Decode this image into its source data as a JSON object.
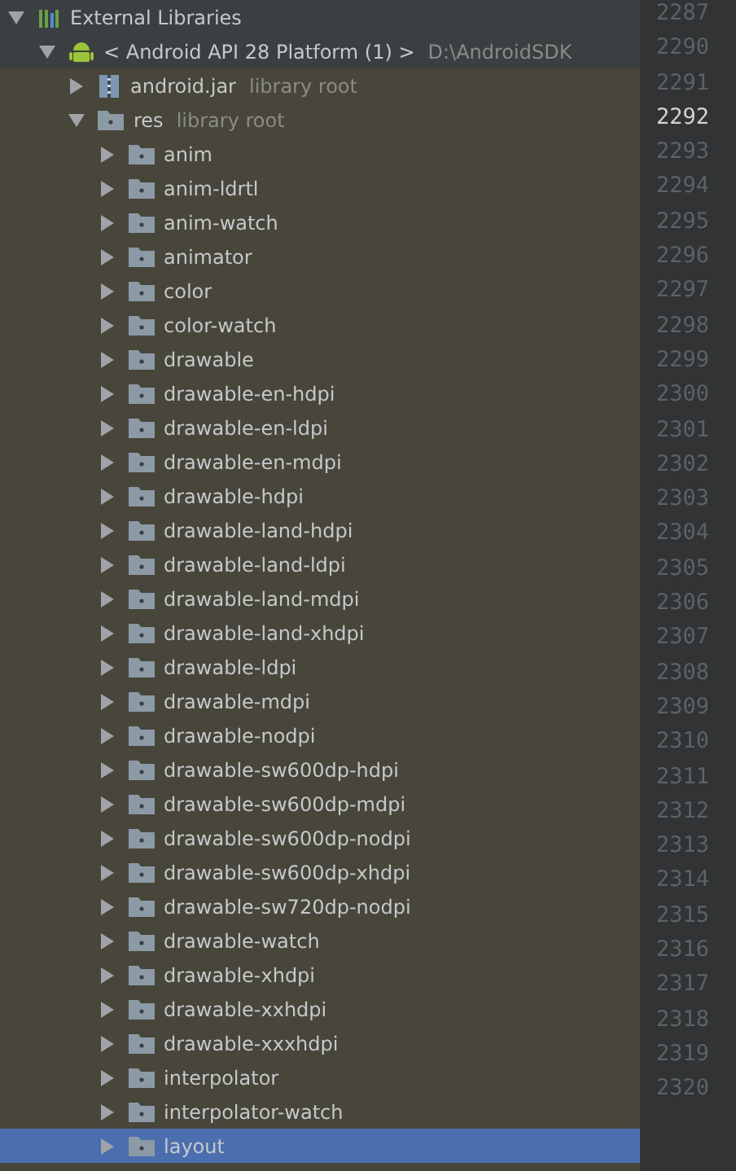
{
  "tree": [
    {
      "label": "External Libraries",
      "kind": "libraries",
      "expanded": true,
      "selected": false,
      "children": [
        {
          "label": "< Android API 28 Platform (1) >",
          "hint": "D:\\AndroidSDK",
          "kind": "sdk",
          "expanded": true,
          "selected": false,
          "children": [
            {
              "label": "android.jar",
              "hint": "library root",
              "kind": "jar",
              "expanded": false,
              "selected": false
            },
            {
              "label": "res",
              "hint": "library root",
              "kind": "root-folder",
              "expanded": true,
              "selected": false,
              "children": [
                {
                  "label": "anim",
                  "kind": "folder",
                  "expanded": false,
                  "selected": false
                },
                {
                  "label": "anim-ldrtl",
                  "kind": "folder",
                  "expanded": false,
                  "selected": false
                },
                {
                  "label": "anim-watch",
                  "kind": "folder",
                  "expanded": false,
                  "selected": false
                },
                {
                  "label": "animator",
                  "kind": "folder",
                  "expanded": false,
                  "selected": false
                },
                {
                  "label": "color",
                  "kind": "folder",
                  "expanded": false,
                  "selected": false
                },
                {
                  "label": "color-watch",
                  "kind": "folder",
                  "expanded": false,
                  "selected": false
                },
                {
                  "label": "drawable",
                  "kind": "folder",
                  "expanded": false,
                  "selected": false
                },
                {
                  "label": "drawable-en-hdpi",
                  "kind": "folder",
                  "expanded": false,
                  "selected": false
                },
                {
                  "label": "drawable-en-ldpi",
                  "kind": "folder",
                  "expanded": false,
                  "selected": false
                },
                {
                  "label": "drawable-en-mdpi",
                  "kind": "folder",
                  "expanded": false,
                  "selected": false
                },
                {
                  "label": "drawable-hdpi",
                  "kind": "folder",
                  "expanded": false,
                  "selected": false
                },
                {
                  "label": "drawable-land-hdpi",
                  "kind": "folder",
                  "expanded": false,
                  "selected": false
                },
                {
                  "label": "drawable-land-ldpi",
                  "kind": "folder",
                  "expanded": false,
                  "selected": false
                },
                {
                  "label": "drawable-land-mdpi",
                  "kind": "folder",
                  "expanded": false,
                  "selected": false
                },
                {
                  "label": "drawable-land-xhdpi",
                  "kind": "folder",
                  "expanded": false,
                  "selected": false
                },
                {
                  "label": "drawable-ldpi",
                  "kind": "folder",
                  "expanded": false,
                  "selected": false
                },
                {
                  "label": "drawable-mdpi",
                  "kind": "folder",
                  "expanded": false,
                  "selected": false
                },
                {
                  "label": "drawable-nodpi",
                  "kind": "folder",
                  "expanded": false,
                  "selected": false
                },
                {
                  "label": "drawable-sw600dp-hdpi",
                  "kind": "folder",
                  "expanded": false,
                  "selected": false
                },
                {
                  "label": "drawable-sw600dp-mdpi",
                  "kind": "folder",
                  "expanded": false,
                  "selected": false
                },
                {
                  "label": "drawable-sw600dp-nodpi",
                  "kind": "folder",
                  "expanded": false,
                  "selected": false
                },
                {
                  "label": "drawable-sw600dp-xhdpi",
                  "kind": "folder",
                  "expanded": false,
                  "selected": false
                },
                {
                  "label": "drawable-sw720dp-nodpi",
                  "kind": "folder",
                  "expanded": false,
                  "selected": false
                },
                {
                  "label": "drawable-watch",
                  "kind": "folder",
                  "expanded": false,
                  "selected": false
                },
                {
                  "label": "drawable-xhdpi",
                  "kind": "folder",
                  "expanded": false,
                  "selected": false
                },
                {
                  "label": "drawable-xxhdpi",
                  "kind": "folder",
                  "expanded": false,
                  "selected": false
                },
                {
                  "label": "drawable-xxxhdpi",
                  "kind": "folder",
                  "expanded": false,
                  "selected": false
                },
                {
                  "label": "interpolator",
                  "kind": "folder",
                  "expanded": false,
                  "selected": false
                },
                {
                  "label": "interpolator-watch",
                  "kind": "folder",
                  "expanded": false,
                  "selected": false
                },
                {
                  "label": "layout",
                  "kind": "folder",
                  "expanded": false,
                  "selected": true
                }
              ]
            }
          ]
        }
      ]
    }
  ],
  "gutter": {
    "lines": [
      {
        "number": "2287",
        "current": false
      },
      {
        "number": "2290",
        "current": false
      },
      {
        "number": "2291",
        "current": false
      },
      {
        "number": "2292",
        "current": true
      },
      {
        "number": "2293",
        "current": false
      },
      {
        "number": "2294",
        "current": false
      },
      {
        "number": "2295",
        "current": false
      },
      {
        "number": "2296",
        "current": false
      },
      {
        "number": "2297",
        "current": false
      },
      {
        "number": "2298",
        "current": false
      },
      {
        "number": "2299",
        "current": false
      },
      {
        "number": "2300",
        "current": false
      },
      {
        "number": "2301",
        "current": false
      },
      {
        "number": "2302",
        "current": false
      },
      {
        "number": "2303",
        "current": false
      },
      {
        "number": "2304",
        "current": false
      },
      {
        "number": "2305",
        "current": false
      },
      {
        "number": "2306",
        "current": false
      },
      {
        "number": "2307",
        "current": false
      },
      {
        "number": "2308",
        "current": false
      },
      {
        "number": "2309",
        "current": false
      },
      {
        "number": "2310",
        "current": false
      },
      {
        "number": "2311",
        "current": false
      },
      {
        "number": "2312",
        "current": false
      },
      {
        "number": "2313",
        "current": false
      },
      {
        "number": "2314",
        "current": false
      },
      {
        "number": "2315",
        "current": false
      },
      {
        "number": "2316",
        "current": false
      },
      {
        "number": "2317",
        "current": false
      },
      {
        "number": "2318",
        "current": false
      },
      {
        "number": "2319",
        "current": false
      },
      {
        "number": "2320",
        "current": false
      }
    ]
  }
}
